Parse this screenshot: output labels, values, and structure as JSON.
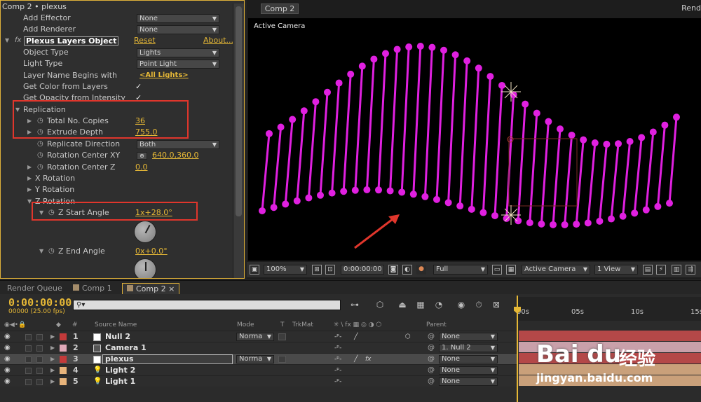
{
  "effect_controls": {
    "title": "Comp 2 • plexus",
    "rows": [
      {
        "label": "Add Effector",
        "value": "None"
      },
      {
        "label": "Add Renderer",
        "value": "None"
      },
      {
        "label": "Plexus Layers Object",
        "reset": "Reset",
        "about": "About..."
      },
      {
        "label": "Object Type",
        "value": "Lights"
      },
      {
        "label": "Light Type",
        "value": "Point Light"
      },
      {
        "label": "Layer Name Begins with",
        "value": "<All Lights>"
      },
      {
        "label": "Get Color from Layers"
      },
      {
        "label": "Get Opacity from Intensity"
      },
      {
        "label": "Replication"
      },
      {
        "label": "Total No. Copies",
        "value": "36"
      },
      {
        "label": "Extrude Depth",
        "value": "755.0"
      },
      {
        "label": "Replicate Direction",
        "value": "Both"
      },
      {
        "label": "Rotation Center XY",
        "value": "640.0,360.0"
      },
      {
        "label": "Rotation Center Z",
        "value": "0.0"
      },
      {
        "label": "X Rotation"
      },
      {
        "label": "Y Rotation"
      },
      {
        "label": "Z Rotation"
      },
      {
        "label": "Z Start Angle",
        "value": "1x+28.0°"
      },
      {
        "label": "Z End Angle",
        "value": "0x+0.0°"
      }
    ]
  },
  "composition": {
    "tab": "Comp 2",
    "render_label": "Rend",
    "view_label": "Active Camera",
    "toolbar": {
      "zoom": "100%",
      "timecode": "0:00:00:00",
      "resolution": "Full",
      "camera": "Active Camera",
      "views": "1 View"
    }
  },
  "tabs": [
    "Render Queue",
    "Comp 1",
    "Comp 2"
  ],
  "timeline": {
    "timecode": "0:00:00:00",
    "fps": "00000 (25.00 fps)",
    "ruler": [
      "00s",
      "05s",
      "10s",
      "15s"
    ],
    "headers": {
      "num": "#",
      "source": "Source Name",
      "mode": "Mode",
      "t": "T",
      "trkmat": "TrkMat",
      "parent": "Parent"
    },
    "layers": [
      {
        "num": "1",
        "name": "Null 2",
        "color": "#c33a3a",
        "mode": "Norma",
        "parent": "None"
      },
      {
        "num": "2",
        "name": "Camera 1",
        "color": "#e0a8b8",
        "mode": "",
        "parent": "1. Null 2"
      },
      {
        "num": "3",
        "name": "plexus",
        "color": "#c33a3a",
        "mode": "Norma",
        "parent": "None"
      },
      {
        "num": "4",
        "name": "Light 2",
        "color": "#e7b37a",
        "mode": "",
        "parent": "None"
      },
      {
        "num": "5",
        "name": "Light 1",
        "color": "#e7b37a",
        "mode": "",
        "parent": "None"
      }
    ]
  },
  "watermark": {
    "logo": "Bai du",
    "cn": "经验",
    "url": "jingyan.baidu.com"
  },
  "colors": {
    "accent": "#e6b836",
    "plexus": "#e020e0",
    "highlight_box": "#e0362c"
  }
}
